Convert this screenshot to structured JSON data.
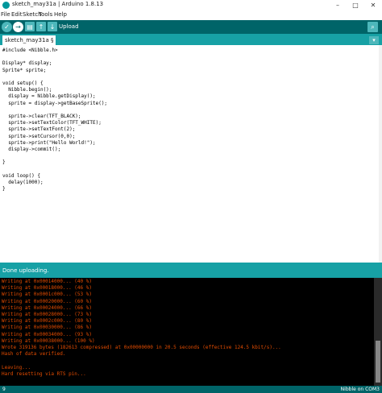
{
  "window": {
    "title": "sketch_may31a | Arduino 1.8.13",
    "minimize": "–",
    "maximize": "□",
    "close": "✕"
  },
  "menu": [
    "File",
    "Edit",
    "Sketch",
    "Tools",
    "Help"
  ],
  "toolbar": {
    "verify_icon": "✓",
    "upload_icon": "→",
    "new_icon": "▤",
    "open_icon": "↑",
    "save_icon": "↓",
    "hover_label": "Upload",
    "serial_icon": "⌕"
  },
  "tabs": {
    "active": "sketch_may31a §",
    "menu_icon": "▾"
  },
  "code": [
    "#include <Nibble.h>",
    "",
    "Display* display;",
    "Sprite* sprite;",
    "",
    "void setup() {",
    "  Nibble.begin();",
    "  display = Nibble.getDisplay();",
    "  sprite = display->getBaseSprite();",
    "",
    "  sprite->clear(TFT_BLACK);",
    "  sprite->setTextColor(TFT_WHITE);",
    "  sprite->setTextFont(2);",
    "  sprite->setCursor(0,0);",
    "  sprite->print(\"Hello World!\");",
    "  display->commit();",
    "",
    "}",
    "",
    "void loop() {",
    "  delay(1000);",
    "}"
  ],
  "status": "Done uploading.",
  "console": [
    "Writing at 0x00014000... (40 %)",
    "Writing at 0x00018000... (46 %)",
    "Writing at 0x0001c000... (53 %)",
    "Writing at 0x00020000... (60 %)",
    "Writing at 0x00024000... (66 %)",
    "Writing at 0x00028000... (73 %)",
    "Writing at 0x0002c000... (80 %)",
    "Writing at 0x00030000... (86 %)",
    "Writing at 0x00034000... (93 %)",
    "Writing at 0x00038000... (100 %)",
    "Wrote 319136 bytes (182613 compressed) at 0x00000000 in 20.5 seconds (effective 124.5 kbit/s)...",
    "Hash of data verified.",
    "",
    "Leaving...",
    "Hard resetting via RTS pin..."
  ],
  "bottom": {
    "line": "9",
    "board": "Nibble on COM3"
  },
  "colors": {
    "toolbar": "#006468",
    "tabbar": "#17a1a5",
    "console_text": "#e34c00"
  }
}
